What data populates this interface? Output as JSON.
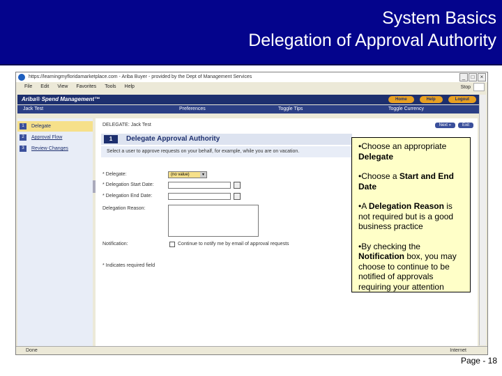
{
  "slide": {
    "title_line1": "System Basics",
    "title_line2": "Delegation of Approval Authority",
    "page_number": "Page - 18"
  },
  "browser": {
    "window_title": "https://learningmyfloridamarketplace.com - Ariba Buyer - provided by the Dept of Management Services",
    "menu": [
      "File",
      "Edit",
      "View",
      "Favorites",
      "Tools",
      "Help"
    ],
    "stop_label": "Stop",
    "status_left": "Done",
    "status_zone": "Internet"
  },
  "ariba": {
    "brand": "Ariba® Spend Management™",
    "top_buttons": [
      "Home",
      "Help",
      "Logout"
    ],
    "user": "Jack Test",
    "nav": [
      "Preferences",
      "Toggle Tips",
      "Toggle Currency"
    ],
    "steps": [
      {
        "num": "1",
        "label": "Delegate"
      },
      {
        "num": "2",
        "label": "Approval Flow"
      },
      {
        "num": "3",
        "label": "Review Changes"
      }
    ],
    "user_line": "DELEGATE: Jack Test",
    "next_buttons": [
      "Next »",
      "Exit"
    ],
    "step_num": "1",
    "step_title": "Delegate Approval Authority",
    "instructions": "Select a user to approve requests on your behalf, for example, while you are on vacation.",
    "fields": {
      "delegate_label": "* Delegate:",
      "delegate_value": "(no value)",
      "start_label": "* Delegation Start Date:",
      "end_label": "* Delegation End Date:",
      "reason_label": "Delegation Reason:",
      "notification_label": "Notification:",
      "notification_text": "Continue to notify me by email of approval requests"
    },
    "required_note": "* Indicates required field"
  },
  "callout": {
    "b1_pre": "•Choose an appropriate ",
    "b1_bold": "Delegate",
    "b2_pre": "•Choose a ",
    "b2_bold": "Start and End Date",
    "b3_pre": "•A ",
    "b3_bold": "Delegation Reason",
    "b3_post": " is not required but is a good business practice",
    "b4_pre": "•By checking the ",
    "b4_bold": "Notification",
    "b4_post": " box, you may choose to continue to be notified of approvals requiring your attention"
  }
}
